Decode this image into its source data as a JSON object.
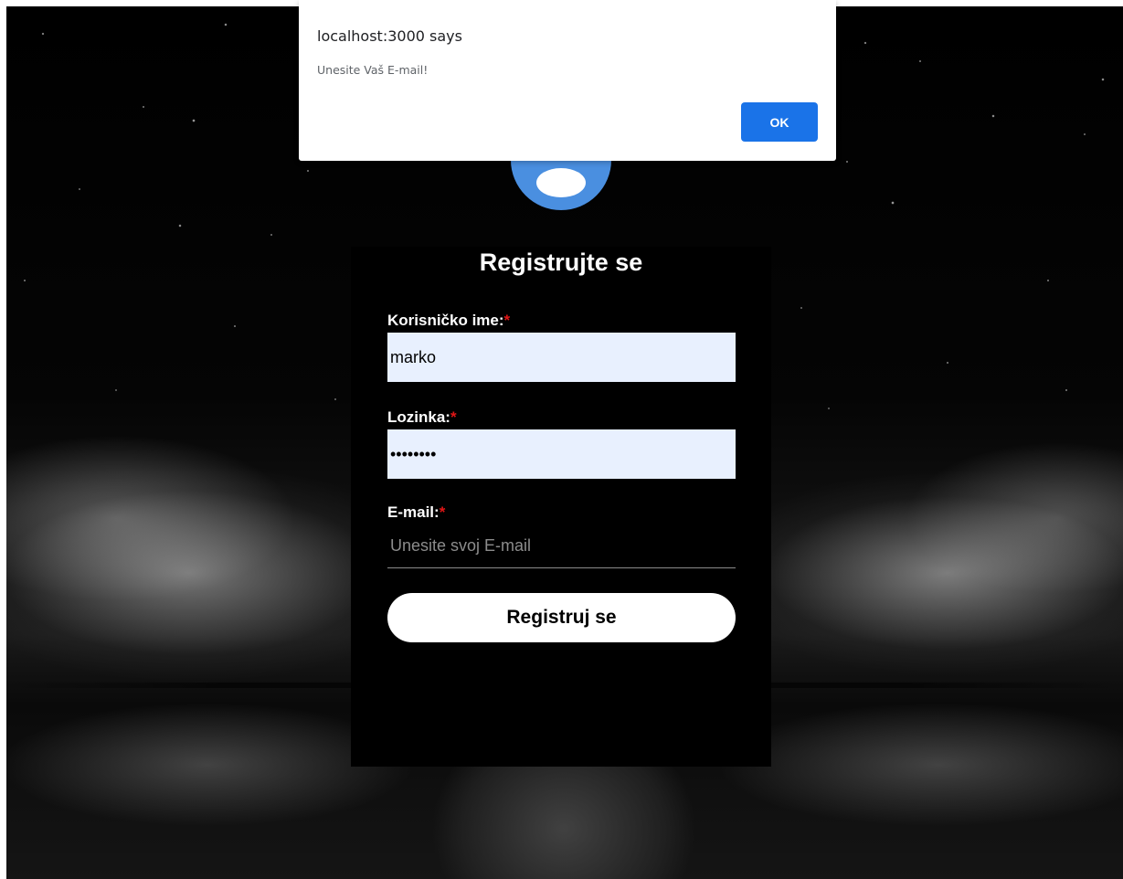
{
  "dialog": {
    "origin": "localhost:3000 says",
    "message": "Unesite Vaš E-mail!",
    "ok_label": "OK"
  },
  "form": {
    "avatar_icon": "user-avatar-icon",
    "title": "Registrujte se",
    "required_marker": "*",
    "username": {
      "label": "Korisničko ime:",
      "value": "marko"
    },
    "password": {
      "label": "Lozinka:",
      "value": "marko123"
    },
    "email": {
      "label": "E-mail:",
      "value": "",
      "placeholder": "Unesite svoj E-mail"
    },
    "submit_label": "Registruj se"
  },
  "colors": {
    "required": "#e01616",
    "dialog_button": "#1a73e8",
    "avatar": "#4a8fe0",
    "autofill_bg": "#e8f0fe"
  }
}
